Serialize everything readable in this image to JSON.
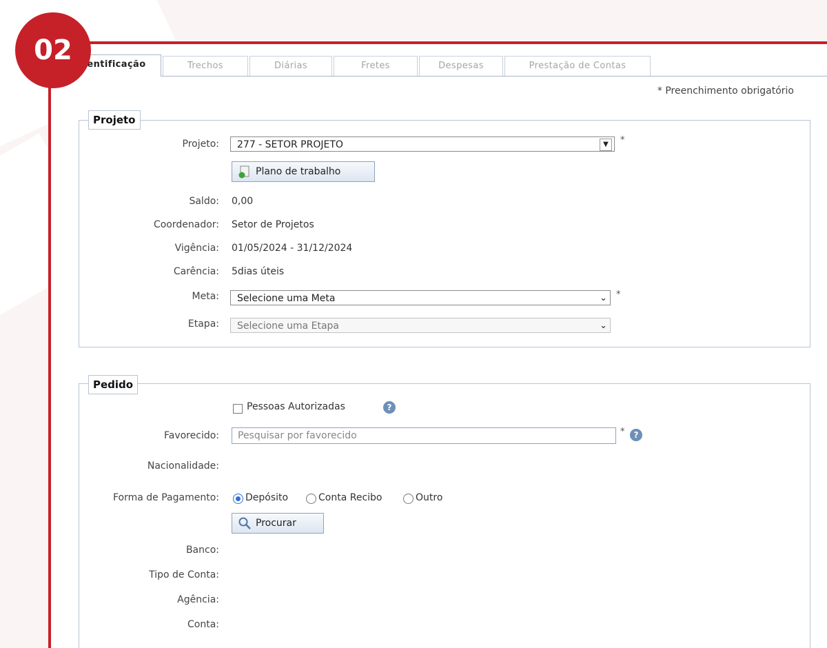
{
  "badge": "02",
  "tabs": [
    "entificação",
    "Trechos",
    "Diárias",
    "Fretes",
    "Despesas",
    "Prestação de Contas"
  ],
  "required_note": "* Preenchimento obrigatório",
  "projeto": {
    "legend": "Projeto",
    "projeto_label": "Projeto:",
    "projeto_value": "277 - SETOR PROJETO",
    "plano_button": "Plano de trabalho",
    "saldo_label": "Saldo:",
    "saldo_value": "0,00",
    "coordenador_label": "Coordenador:",
    "coordenador_value": "Setor de Projetos",
    "vigencia_label": "Vigência:",
    "vigencia_value": "01/05/2024 - 31/12/2024",
    "carencia_label": "Carência:",
    "carencia_value": "5dias úteis",
    "meta_label": "Meta:",
    "meta_value": "Selecione uma Meta",
    "etapa_label": "Etapa:",
    "etapa_value": "Selecione uma Etapa",
    "star": "*"
  },
  "pedido": {
    "legend": "Pedido",
    "autorizadas_label": "Pessoas Autorizadas",
    "favorecido_label": "Favorecido:",
    "favorecido_placeholder": "Pesquisar por favorecido",
    "nacionalidade_label": "Nacionalidade:",
    "pagamento_label": "Forma de Pagamento:",
    "pagamento_options": [
      "Depósito",
      "Conta Recibo",
      "Outro"
    ],
    "pagamento_selected": "Depósito",
    "procurar_button": "Procurar",
    "banco_label": "Banco:",
    "tipo_conta_label": "Tipo de Conta:",
    "agencia_label": "Agência:",
    "conta_label": "Conta:",
    "star": "*"
  },
  "icons": {
    "help": "?",
    "dropdown": "▼",
    "chevron": "⌄"
  },
  "colors": {
    "accent_red": "#c62129",
    "radio_blue": "#2d6fd8",
    "border_blue": "#b7c4d6"
  }
}
